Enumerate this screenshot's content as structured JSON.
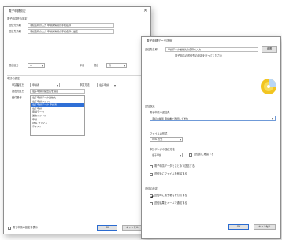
{
  "back_dialog": {
    "title": "電子申請設定",
    "group1_label": "電子申請先の設定",
    "field1_label": "送信先情報",
    "field1_value": "手続名称の入力 申請先情報の手続名称",
    "field2_label": "送信先情報",
    "field2_value": "手続名称の入力 申請先情報の手続名称を設定",
    "row_label": "提出区分",
    "row_combo1": "1",
    "row_mid_label": "年月",
    "row_mid_label2": "提出",
    "row_combo2": "月",
    "group2_label": "申請の設定",
    "list_row1_label": "申請者区分",
    "list_row1_combo": "申請者",
    "list_row1_mid_label": "申請方法",
    "list_row1_combo2": "電子申請",
    "list_row2_label": "提出先区分",
    "list_row2_value": "電子申請の提出先を指定",
    "list_row3_label": "受付番号",
    "list_items": [
      "電子申請データ送信先",
      "電子申請ファイル",
      "電子申請データ 申請者",
      "電子申請",
      "申請データ",
      "送信ファイル",
      "申請",
      "XML ファイル",
      "テキスト"
    ],
    "bottom_checkbox": "電子申請の設定を表示",
    "ok": "OK",
    "cancel": "キャンセル"
  },
  "front_dialog": {
    "title": "電子申請データ送信",
    "top_label": "送信先名称",
    "top_value": "申請データ送信先の名称を入力",
    "top_button": "参照",
    "subtitle": "電子申請の送信先の設定を行ってください",
    "section_label": "送信設定",
    "sub1_label": "電子申請の送信先",
    "sub1_combo": "手続の種別 申請書を選択して送信",
    "sub2_label": "ファイルの形式",
    "sub2_combo": "XML 形式",
    "sub3_label": "申請データの送信方法",
    "sub3_combo": "電子申請",
    "sub3_check": "送信前に確認する",
    "check_a": "電子申請データをまとめて送信する",
    "check_b": "送信後にファイルを削除する",
    "section2_label": "送信の設定",
    "check_c": "送信時に電子署名を付与する",
    "check_d": "送信結果をメールで通知する",
    "ok": "OK",
    "cancel": "キャンセル"
  },
  "colors": {
    "accent": "#2f6fd6",
    "icon_yellow": "#f2c521"
  }
}
